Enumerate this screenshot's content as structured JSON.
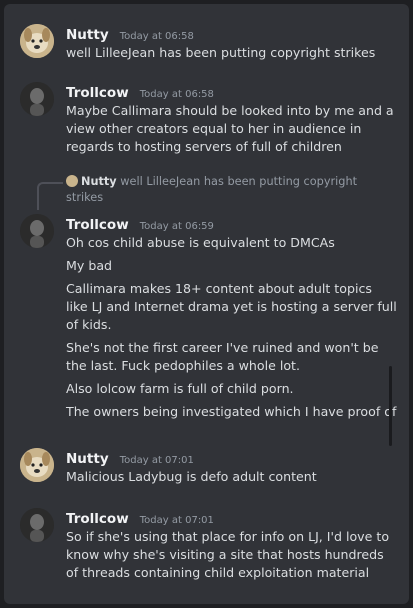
{
  "messages": [
    {
      "author": "Nutty",
      "time": "Today at 06:58",
      "avatar": "dog-avatar",
      "lines": [
        "well LilleeJean has been putting copyright strikes"
      ]
    },
    {
      "author": "Trollcow",
      "time": "Today at 06:58",
      "avatar": "person-avatar",
      "lines": [
        "Maybe Callimara should be looked into by me and a view other creators equal to her in audience in regards to hosting servers of full of children"
      ]
    },
    {
      "author": "Trollcow",
      "time": "Today at 06:59",
      "avatar": "person-avatar",
      "reply": {
        "author": "Nutty",
        "text": "well LilleeJean has been putting copyright strikes"
      },
      "lines": [
        "Oh cos child abuse is equivalent to DMCAs",
        "My bad",
        "Callimara makes 18+ content about adult topics like LJ and Internet drama yet is hosting a server full of kids.",
        "She's not the first career I've ruined and won't be the last. Fuck pedophiles a whole lot.",
        "Also lolcow farm is full of child porn.",
        "The owners being investigated which I have proof of"
      ]
    },
    {
      "author": "Nutty",
      "time": "Today at 07:01",
      "avatar": "dog-avatar",
      "lines": [
        "Malicious Ladybug is defo adult content"
      ]
    },
    {
      "author": "Trollcow",
      "time": "Today at 07:01",
      "avatar": "person-avatar",
      "lines": [
        "So if she's using that place for info on LJ, I'd love to know why she's visiting a site that hosts hundreds of threads containing child exploitation material"
      ]
    }
  ]
}
